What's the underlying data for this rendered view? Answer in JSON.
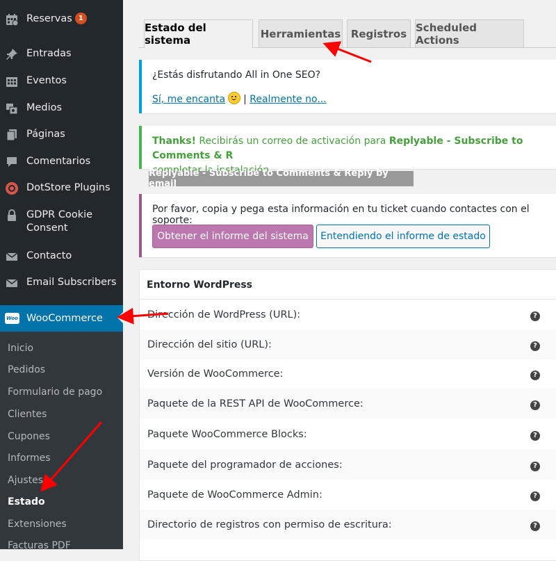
{
  "sidebar": {
    "items": [
      {
        "label": "Reservas",
        "icon": "calendar-icon",
        "badge": "1"
      },
      {
        "label": "Entradas",
        "icon": "pin-icon"
      },
      {
        "label": "Eventos",
        "icon": "calendar-grid-icon"
      },
      {
        "label": "Medios",
        "icon": "media-icon"
      },
      {
        "label": "Páginas",
        "icon": "pages-icon"
      },
      {
        "label": "Comentarios",
        "icon": "comment-icon"
      },
      {
        "label": "DotStore Plugins",
        "icon": "dotstore-icon"
      },
      {
        "label": "GDPR Cookie Consent",
        "icon": "lock-icon"
      },
      {
        "label": "Contacto",
        "icon": "mail-icon"
      },
      {
        "label": "Email Subscribers",
        "icon": "mail-icon"
      }
    ],
    "woocommerce": {
      "label": "WooCommerce",
      "logo_text": "Woo"
    },
    "submenu": [
      "Inicio",
      "Pedidos",
      "Formulario de pago",
      "Clientes",
      "Cupones",
      "Informes",
      "Ajustes",
      "Estado",
      "Extensiones",
      "Facturas PDF"
    ],
    "current_submenu": "Estado"
  },
  "tabs": [
    "Estado del sistema",
    "Herramientas",
    "Registros",
    "Scheduled Actions"
  ],
  "active_tab": "Estado del sistema",
  "aioseo_notice": {
    "question": "¿Estás disfrutando All in One SEO?",
    "yes_link": "Sí, me encanta",
    "separator": "|",
    "no_link": "Realmente no..."
  },
  "thanks_notice": {
    "bold": "Thanks!",
    "text_before": " Recibirás un correo de activación para ",
    "plugin_name": "Replyable - Subscribe to Comments & R",
    "line2": "completar la instalación."
  },
  "replyable_tag": "Replyable - Subscribe to Comments & Reply by email",
  "support_notice": {
    "text": "Por favor, copia y pega esta información en tu ticket cuando contactes con el soporte:",
    "report_button": "Obtener el informe del sistema",
    "understand_button": "Entendiendo el informe de estado"
  },
  "status_table": {
    "heading": "Entorno WordPress",
    "rows": [
      "Dirección de WordPress (URL):",
      "Dirección del sitio (URL):",
      "Versión de WooCommerce:",
      "Paquete de la REST API de WooCommerce:",
      "Paquete WooCommerce Blocks:",
      "Paquete del programador de acciones:",
      "Paquete de WooCommerce Admin:",
      "Directorio de registros con permiso de escritura:"
    ],
    "help_glyph": "?"
  },
  "colors": {
    "sidebar_bg": "#23282d",
    "submenu_bg": "#32373c",
    "active_menu": "#0073aa",
    "badge": "#d54e21",
    "woo_purple": "#bb77ae",
    "annotation_arrow": "#ff0000"
  }
}
